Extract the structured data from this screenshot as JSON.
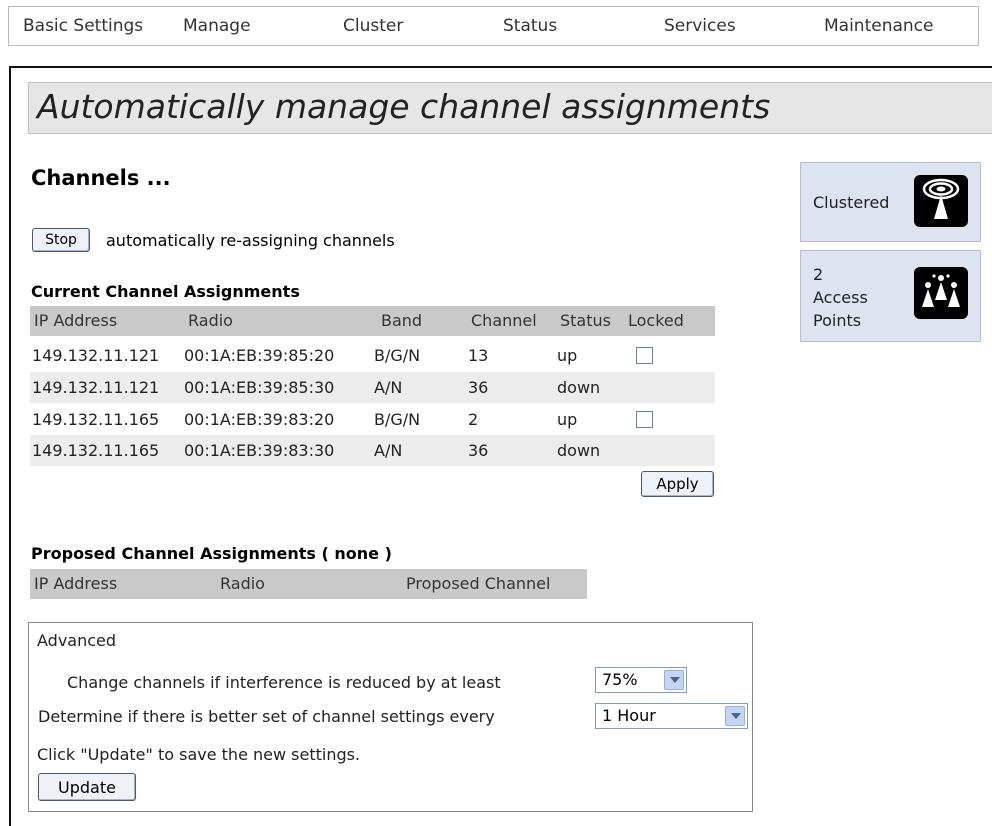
{
  "nav": {
    "tabs": [
      {
        "label": "Basic Settings"
      },
      {
        "label": "Manage"
      },
      {
        "label": "Cluster"
      },
      {
        "label": "Status"
      },
      {
        "label": "Services"
      },
      {
        "label": "Maintenance"
      }
    ]
  },
  "page": {
    "banner_title": "Automatically manage channel assignments",
    "heading": "Channels ..."
  },
  "controls": {
    "stop_label": "Stop",
    "status_text": "automatically re-assigning channels",
    "apply_label": "Apply"
  },
  "current": {
    "title": "Current Channel Assignments",
    "columns": [
      "IP Address",
      "Radio",
      "Band",
      "Channel",
      "Status",
      "Locked"
    ],
    "rows": [
      {
        "ip": "149.132.11.121",
        "radio": "00:1A:EB:39:85:20",
        "band": "B/G/N",
        "channel": "13",
        "status": "up",
        "locked": false,
        "has_lock": true
      },
      {
        "ip": "149.132.11.121",
        "radio": "00:1A:EB:39:85:30",
        "band": "A/N",
        "channel": "36",
        "status": "down",
        "locked": false,
        "has_lock": false
      },
      {
        "ip": "149.132.11.165",
        "radio": "00:1A:EB:39:83:20",
        "band": "B/G/N",
        "channel": "2",
        "status": "up",
        "locked": false,
        "has_lock": true
      },
      {
        "ip": "149.132.11.165",
        "radio": "00:1A:EB:39:83:30",
        "band": "A/N",
        "channel": "36",
        "status": "down",
        "locked": false,
        "has_lock": false
      }
    ]
  },
  "proposed": {
    "title": "Proposed Channel Assignments ( none )",
    "columns": [
      "IP Address",
      "Radio",
      "Proposed Channel"
    ]
  },
  "advanced": {
    "title": "Advanced",
    "interference_label": "Change channels if interference is reduced by at least",
    "interference_value": "75%",
    "interval_label": "Determine if there is better set of channel settings every",
    "interval_value": "1 Hour",
    "hint": "Click \"Update\" to save the new settings.",
    "update_label": "Update"
  },
  "sidebar": {
    "clustered_label": "Clustered",
    "ap_count": "2",
    "ap_label_1": "Access",
    "ap_label_2": "Points"
  },
  "icons": {
    "clustered": "wireless-cluster-icon",
    "access_points": "access-points-icon"
  },
  "colors": {
    "header_row": "#c9c9c9",
    "alt_row": "#ececec",
    "tile_bg": "#dde3ef",
    "banner_bg": "#e6e6e6"
  }
}
